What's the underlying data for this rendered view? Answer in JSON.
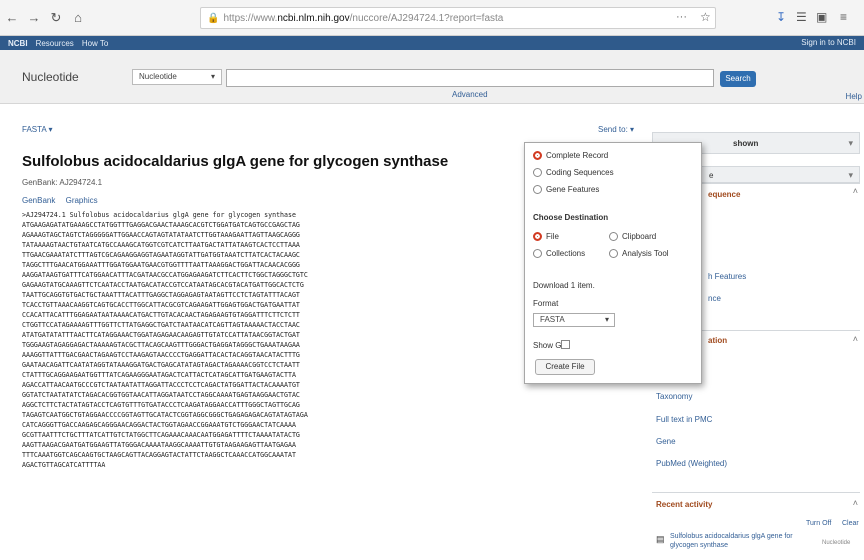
{
  "browser": {
    "url_prefix": "https://www.",
    "url_host": "ncbi.nlm.nih.gov",
    "url_path": "/nuccore/AJ294724.1?report=fasta",
    "url_more": "···"
  },
  "ncbi_bar": {
    "logo": "NCBI",
    "resources": "Resources",
    "how_to": "How To",
    "sign_in": "Sign in to NCBI"
  },
  "search": {
    "db_title": "Nucleotide",
    "db_value": "Nucleotide",
    "search_label": "Search",
    "advanced": "Advanced",
    "help": "Help"
  },
  "record": {
    "format_link": "FASTA",
    "send_to": "Send to:",
    "title": "Sulfolobus acidocaldarius glgA gene for glycogen synthase",
    "genbank_id": "GenBank: AJ294724.1",
    "links": [
      "GenBank",
      "Graphics"
    ],
    "sequence": [
      ">AJ294724.1 Sulfolobus acidocaldarius glgA gene for glycogen synthase",
      "ATGAAGAGATATGAAAGCCTATGGTTTGAGGACGAACTAAAGCACGTCTGGATGATCAGTGCCGAGCTAG",
      "AGAAAGTAGCTAGTCTAGGGGGATTGGAACCAGTAGTATATAATCTTGGTAAAGAATTAGTTAAGCAGGG",
      "TATAAAAGTAACTGTAATCATGCCAAAGCATGGTCGTCATCTTAATGACTATTATAAGTCACTCCTTAAA",
      "TTGAACGAAATATCTTTAGTCGCAGAAGGAGGTAGAATAGGTATTGATGGTAAATCTTATCACTACAAGC",
      "TAGGCTTTGAACATGGAAATTTGGATGGAATGAACGTGGTTTTAATTAAAGGACTGGATTACAACACGGG",
      "AAGGATAAGTGATTTCATGGAACATTTACGATAACGCCATGGAGAAGATCTTCACTTCTGGCTAGGGCTGTC",
      "GAGAAGTATGCAAAGTTCTCAATACCTAATGACATACCGTCCATAATAGCACGTACATGATTGGCACTCTG",
      "TAATTGCAGGTGTGACTGCTAAATTTACATTTGAGGCTAGGAGAGTAATAGTTCCTCTAGTATTTACAGT",
      "TCACCTGTTAAACAAGGTCAGTGCACCTTGGCATTACGCGTCAGAAGATTGGAGTGGACTGATGAATTAT",
      "CCACATTACATTTGGAGAATAATAAAACATGACTTGTACACAACTAGAGAAGTGTAGGATTTCTTCTCTT",
      "CTGGTTCCATAGAAAAGTTTGGTTCTTATGAGGCTGATCTAATAACATCAGTTAGTAAAAACTACCTAAC",
      "ATATGATATATTTAACTTCATAGGAAACTGGATAGAGAACAAGAGTTGTATCCATTATAACGGTACTGAT",
      "TGGGAAGTAGAGGAGACTAAAAAGTACGCTTACAGCAAGTTTGGGACTGAGGATAGGGCTGAAATAAGAA",
      "AAAGGTTATTTGACGAACTAGAAGTCCTAAGAGTAACCCCTGAGGATTACACTACAGGTAACATACTTTG",
      "GAATAACAGATTCAATATAGGTATAAAGGATGACTGAGCATATAGTAGACTAGAAAACGGTCCTCTAATT",
      "CTATTTGCAGGAAGAATGGTTTATCAGAAGGGAATAGACTCATTACTCATAGCATTGATGAAGTACTTA",
      "AGACCATTAACAATGCCCGTCTAATAATATTAGGATTACCCTCCTCAGACTATGGATTACTACAAAATGT",
      "GGTATCTAATATATCTAGACACGGTGGTAACATTAGGATAATCCTAGGCAAAATGAGTAAGGAACTGTAC",
      "AGGCTCTTCTACTATAGTACCTCAGTGTTTGTGATACCCTCAAGATAGGAACCATTTGGGCTAGTTGCAG",
      "TAGAGTCAATGGCTGTAGGAACCCCGGTAGTTGCATACTCGGTAGGCGGGCTGAGAGAGACAGTATAGTAGA",
      "CATCAGGGTTGACCAAGAGCAGGGAACAGGACTACTGGTAGAACCGGAAATGTCTGGGAACTATCAAAA",
      "GCGTTAATTTCTGCTTTATCATTGTCTATGGCTTCAGAAACAAACAATGGAGATTTTCTAAAATATACTG",
      "AAGTTAAGACGAATGATGGAAGTTATGGGACAAAATAAGGCAAAATTGTGTAAGAAGAGTTAATGAGAA",
      "TTTCAAATGGTCAGCAAGTGCTAAGCAGTTACAGGAGTACTATTCTAAGGCTCAAACCATGGCAAATAT",
      "AGACTGTTAGCATCATTTTAA"
    ]
  },
  "popup": {
    "dest_options": [
      "Complete Record",
      "Coding Sequences",
      "Gene Features"
    ],
    "choose_dest": "Choose Destination",
    "dest_file": "File",
    "dest_clipboard": "Clipboard",
    "dest_collections": "Collections",
    "dest_analysis": "Analysis Tool",
    "download_count": "Download 1 item.",
    "format_label": "Format",
    "format_value": "FASTA",
    "show_gi": "Show GI",
    "create_button": "Create File"
  },
  "sidebar": {
    "change_region": "shown",
    "customize": "e",
    "analyze_head": "equence",
    "tools": [
      "h Features",
      "nce"
    ],
    "articles_head": "ation",
    "related": [
      "Taxonomy",
      "Full text in PMC",
      "Gene",
      "PubMed (Weighted)"
    ],
    "recent_head": "Recent activity",
    "turn_off": "Turn Off",
    "clear": "Clear",
    "recent_item": "Sulfolobus acidocaldarius glgA gene for glycogen synthase",
    "recent_db": "Nucleotide"
  }
}
